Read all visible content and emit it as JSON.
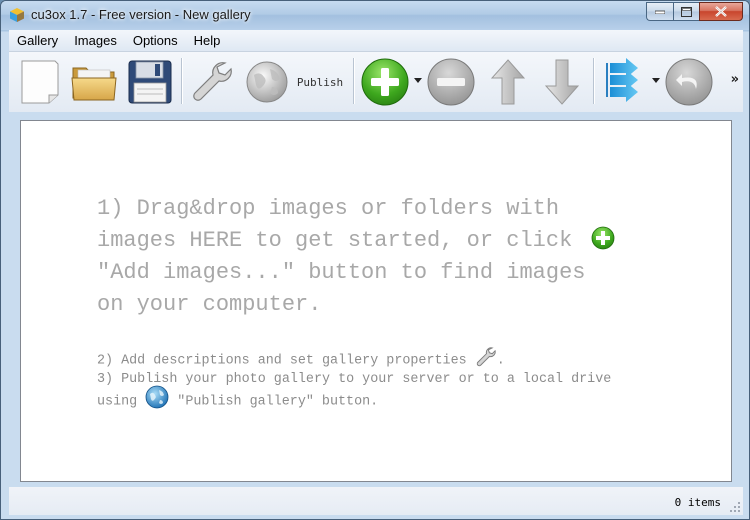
{
  "window": {
    "title": "cu3ox 1.7 - Free version - New gallery"
  },
  "menubar": {
    "items": [
      "Gallery",
      "Images",
      "Options",
      "Help"
    ]
  },
  "toolbar": {
    "buttons": [
      {
        "name": "new-gallery",
        "icon": "blank-page-icon"
      },
      {
        "name": "open-gallery",
        "icon": "folder-icon"
      },
      {
        "name": "save-gallery",
        "icon": "floppy-disk-icon"
      },
      {
        "name": "gallery-properties",
        "icon": "wrench-icon"
      },
      {
        "name": "publish",
        "icon": "globe-icon",
        "label": "Publish"
      },
      {
        "name": "add-images",
        "icon": "green-plus-icon",
        "has_dropdown": true
      },
      {
        "name": "remove-images",
        "icon": "grey-minus-icon"
      },
      {
        "name": "move-up",
        "icon": "up-arrow-icon"
      },
      {
        "name": "move-down",
        "icon": "down-arrow-icon"
      },
      {
        "name": "sort",
        "icon": "blue-arrows-icon",
        "has_dropdown": true
      },
      {
        "name": "undo",
        "icon": "undo-icon"
      }
    ],
    "overflow_chevron": "»"
  },
  "content": {
    "step1_line1": "1) Drag&drop images or folders with",
    "step1_line2": "images HERE to get started, or click",
    "step1_line3": "\"Add images...\" button to find images",
    "step1_line4": "on your computer.",
    "step2": "2) Add descriptions and set gallery properties",
    "step2_end": ".",
    "step3_line1": "3) Publish your photo gallery to your server or to a local drive",
    "step3_line2_a": "using",
    "step3_line2_b": "\"Publish gallery\" button."
  },
  "statusbar": {
    "items_count": "0 items"
  },
  "colors": {
    "hint_text": "#a8a8a8",
    "add_green": "#3aa520",
    "title_bar": "#b1cbe6"
  }
}
